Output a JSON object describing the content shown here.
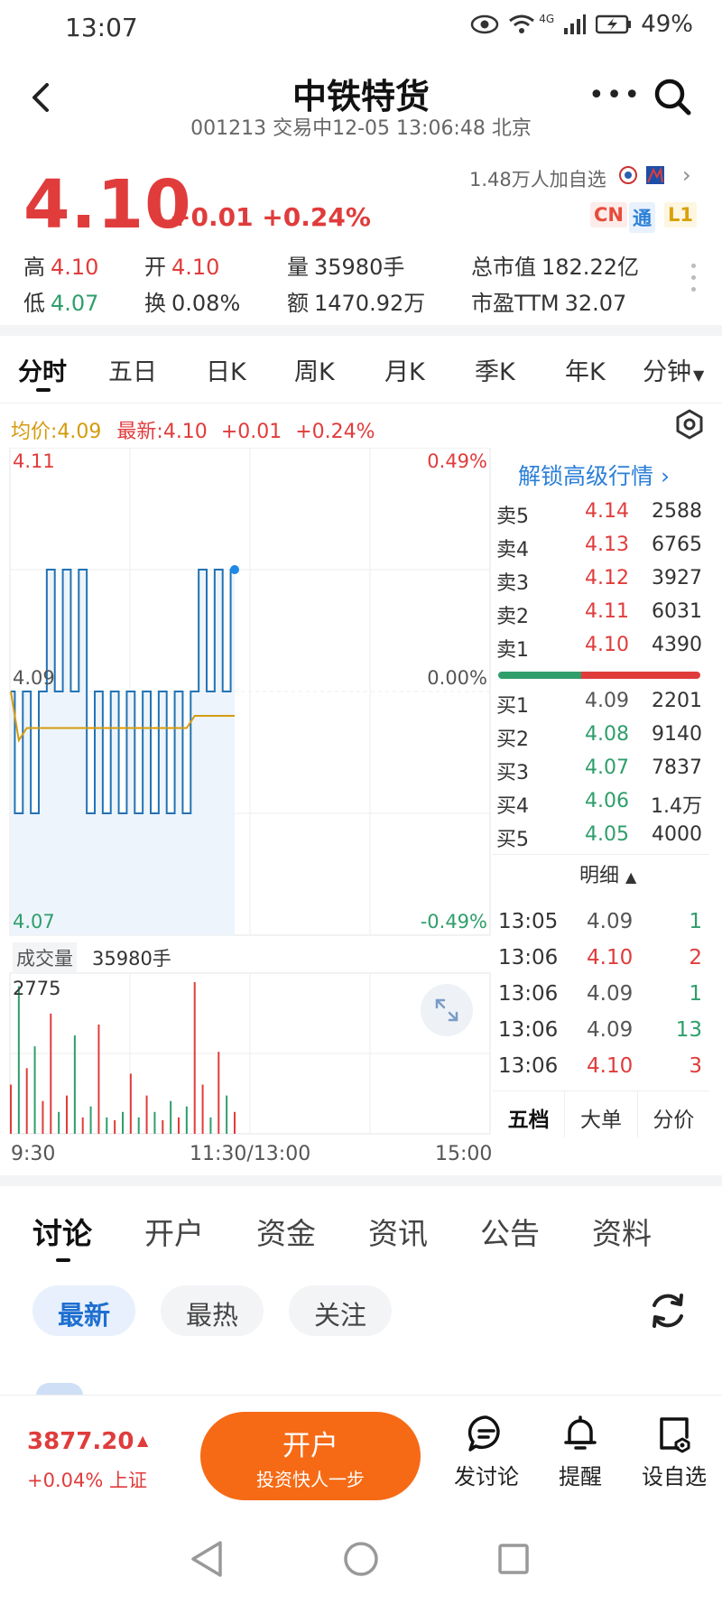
{
  "status_bar": {
    "time": "13:07",
    "network": "4G",
    "battery": "49%"
  },
  "header": {
    "title": "中铁特货",
    "subtitle": "001213 交易中12-05 13:06:48 北京",
    "more_icon": "more-dots-icon",
    "search_icon": "search-icon",
    "back_icon": "back-chevron-icon"
  },
  "quote": {
    "price": "4.10",
    "change": "+0.01 +0.24%",
    "watchers": "1.48万人加自选",
    "tags": [
      "CN",
      "通",
      "L1"
    ]
  },
  "stats": [
    {
      "label": "高",
      "value": "4.10",
      "color": "red"
    },
    {
      "label": "开",
      "value": "4.10",
      "color": "red"
    },
    {
      "label": "量",
      "value": "35980手",
      "color": "plain"
    },
    {
      "label": "总市值",
      "value": "182.22亿",
      "color": "plain"
    },
    {
      "label": "低",
      "value": "4.07",
      "color": "green"
    },
    {
      "label": "换",
      "value": "0.08%",
      "color": "plain"
    },
    {
      "label": "额",
      "value": "1470.92万",
      "color": "plain"
    },
    {
      "label": "市盈TTM",
      "value": "32.07",
      "color": "plain"
    }
  ],
  "chart_tabs": [
    "分时",
    "五日",
    "日K",
    "周K",
    "月K",
    "季K",
    "年K",
    "分钟"
  ],
  "avg_line": {
    "avg": "均价:4.09",
    "latest": "最新:4.10",
    "change": "+0.01",
    "pct": "+0.24%"
  },
  "chart_labels": {
    "top_price": "4.11",
    "top_pct": "0.49%",
    "mid_price": "4.09",
    "mid_pct": "0.00%",
    "bottom_price": "4.07",
    "bottom_pct": "-0.49%",
    "volume_label": "成交量",
    "volume_value": "35980手",
    "volume_max": "2775",
    "time_start": "9:30",
    "time_mid": "11:30/13:00",
    "time_end": "15:00"
  },
  "chart_data": {
    "type": "line",
    "title": "",
    "series": [
      {
        "name": "最新",
        "values": [
          4.09,
          4.08,
          4.09,
          4.08,
          4.09,
          4.1,
          4.09,
          4.1,
          4.09,
          4.1,
          4.08,
          4.09,
          4.08,
          4.09,
          4.08,
          4.09,
          4.08,
          4.09,
          4.08,
          4.09,
          4.08,
          4.09,
          4.08,
          4.09,
          4.1,
          4.09,
          4.1,
          4.09,
          4.1
        ]
      },
      {
        "name": "均价",
        "values": [
          4.09,
          4.086,
          4.087,
          4.087,
          4.087,
          4.087,
          4.087,
          4.087,
          4.087,
          4.087,
          4.087,
          4.087,
          4.087,
          4.087,
          4.087,
          4.087,
          4.087,
          4.087,
          4.087,
          4.087,
          4.087,
          4.087,
          4.087,
          4.088,
          4.088,
          4.088,
          4.088,
          4.088,
          4.088
        ]
      }
    ],
    "ylim": [
      4.07,
      4.11
    ],
    "volume": {
      "max": 2775,
      "values": [
        900,
        2700,
        1200,
        1600,
        600,
        2200,
        400,
        700,
        1800,
        300,
        500,
        2000,
        300,
        250,
        400,
        1100,
        300,
        700,
        400,
        250,
        600,
        300,
        500,
        2775,
        900,
        300,
        1500,
        700,
        400
      ]
    }
  },
  "order_book": {
    "unlock": "解锁高级行情",
    "sells": [
      {
        "name": "卖5",
        "price": "4.14",
        "qty": "2588"
      },
      {
        "name": "卖4",
        "price": "4.13",
        "qty": "6765"
      },
      {
        "name": "卖3",
        "price": "4.12",
        "qty": "3927"
      },
      {
        "name": "卖2",
        "price": "4.11",
        "qty": "6031"
      },
      {
        "name": "卖1",
        "price": "4.10",
        "qty": "4390"
      }
    ],
    "buys": [
      {
        "name": "买1",
        "price": "4.09",
        "qty": "2201"
      },
      {
        "name": "买2",
        "price": "4.08",
        "qty": "9140"
      },
      {
        "name": "买3",
        "price": "4.07",
        "qty": "7837"
      },
      {
        "name": "买4",
        "price": "4.06",
        "qty": "1.4万"
      },
      {
        "name": "买5",
        "price": "4.05",
        "qty": "4000"
      }
    ],
    "detail_header": "明细",
    "trades": [
      {
        "time": "13:05",
        "price": "4.09",
        "qty": "1",
        "dir": "buy"
      },
      {
        "time": "13:06",
        "price": "4.10",
        "qty": "2",
        "dir": "sell"
      },
      {
        "time": "13:06",
        "price": "4.09",
        "qty": "1",
        "dir": "buy"
      },
      {
        "time": "13:06",
        "price": "4.09",
        "qty": "13",
        "dir": "buy"
      },
      {
        "time": "13:06",
        "price": "4.10",
        "qty": "3",
        "dir": "sell"
      }
    ],
    "tabs": [
      "五档",
      "大单",
      "分价"
    ]
  },
  "section_tabs": [
    "讨论",
    "开户",
    "资金",
    "资讯",
    "公告",
    "资料"
  ],
  "filters": [
    "最新",
    "最热",
    "关注"
  ],
  "bottom_bar": {
    "index_value": "3877.20",
    "index_change": "+0.04% 上证",
    "open_main": "开户",
    "open_sub": "投资快人一步",
    "actions": [
      {
        "label": "发讨论",
        "icon": "chat-icon"
      },
      {
        "label": "提醒",
        "icon": "bell-icon"
      },
      {
        "label": "设自选",
        "icon": "add-watchlist-icon"
      }
    ]
  },
  "colors": {
    "up": "#e03c3c",
    "down": "#2f9e6b",
    "avg": "#d49b0e",
    "price_line": "#2273b5",
    "accent": "#f66a15"
  }
}
